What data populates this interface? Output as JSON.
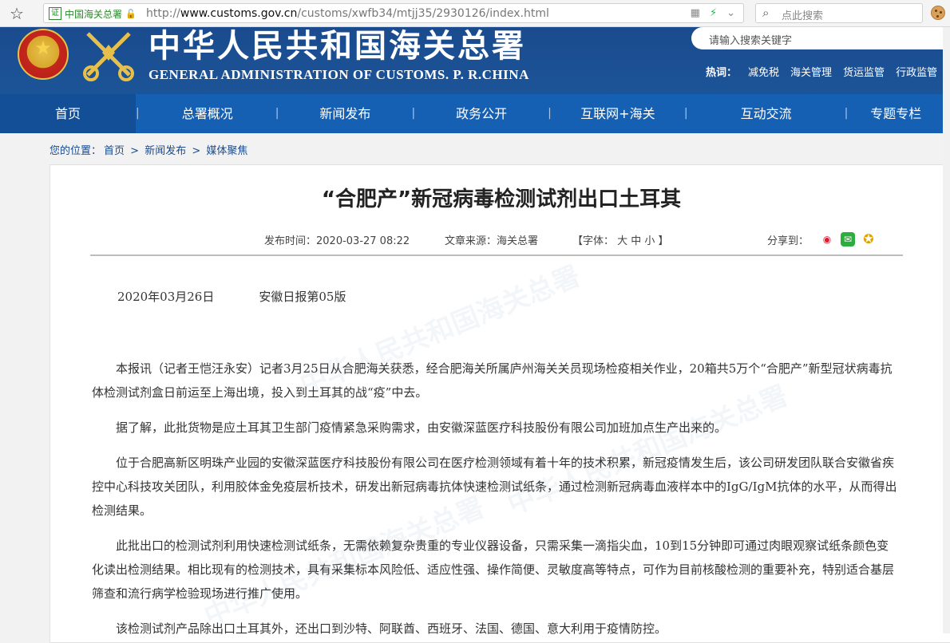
{
  "browser": {
    "site_badge": "证",
    "site_name": "中国海关总署",
    "url_prefix": "http://",
    "url_domain": "www.customs.gov.cn",
    "url_path": "/customs/xwfb34/mtjj35/2930126/index.html",
    "search_placeholder": "点此搜索"
  },
  "header": {
    "title_cn": "中华人民共和国海关总署",
    "title_en": "GENERAL ADMINISTRATION OF CUSTOMS. P. R.CHINA",
    "search_placeholder": "请输入搜索关键字",
    "hot_label": "热词：",
    "hot_words": [
      "减免税",
      "海关管理",
      "货运监管",
      "行政监管"
    ]
  },
  "nav": {
    "items": [
      "首页",
      "总署概况",
      "新闻发布",
      "政务公开",
      "互联网+海关",
      "互动交流",
      "专题专栏"
    ],
    "separator": "|"
  },
  "breadcrumb": {
    "prefix": "您的位置：",
    "items": [
      "首页",
      "新闻发布",
      "媒体聚焦"
    ],
    "sep": ">"
  },
  "article": {
    "title": "“合肥产”新冠病毒检测试剂出口土耳其",
    "publish_time": "发布时间：2020-03-27 08:22",
    "source": "文章来源：海关总署",
    "font_size": "【字体： 大  中  小 】",
    "share_label": "分享到：",
    "date": "2020年03月26日",
    "paper": "安徽日报第05版",
    "paragraphs": [
      "本报讯（记者王恺汪永安）记者3月25日从合肥海关获悉，经合肥海关所属庐州海关关员现场检疫相关作业，20箱共5万个“合肥产”新型冠状病毒抗体检测试剂盒日前运至上海出境，投入到土耳其的战“疫”中去。",
      "据了解，此批货物是应土耳其卫生部门疫情紧急采购需求，由安徽深蓝医疗科技股份有限公司加班加点生产出来的。",
      "位于合肥高新区明珠产业园的安徽深蓝医疗科技股份有限公司在医疗检测领域有着十年的技术积累，新冠疫情发生后，该公司研发团队联合安徽省疾控中心科技攻关团队，利用胶体金免疫层析技术，研发出新冠病毒抗体快速检测试纸条，通过检测新冠病毒血液样本中的IgG/IgM抗体的水平，从而得出检测结果。",
      "此批出口的检测试剂利用快速检测试纸条，无需依赖复杂贵重的专业仪器设备，只需采集一滴指尖血，10到15分钟即可通过肉眼观察试纸条颜色变化读出检测结果。相比现有的检测技术，具有采集标本风险低、适应性强、操作简便、灵敏度高等特点，可作为目前核酸检测的重要补充，特别适合基层筛查和流行病学检验现场进行推广使用。",
      "该检测试剂产品除出口土耳其外，还出口到沙特、阿联酋、西班牙、法国、德国、意大利用于疫情防控。"
    ]
  },
  "colors": {
    "header_blue": "#1a4b8e",
    "nav_blue": "#1660b3",
    "link_blue": "#1a4b8e"
  }
}
